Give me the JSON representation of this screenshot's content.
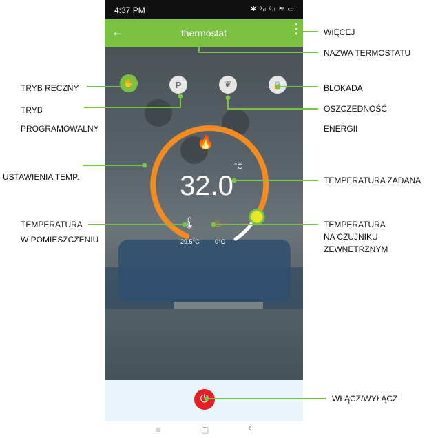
{
  "status_bar": {
    "time": "4:37 PM",
    "icons": "✱ ᵃᵢₗ ᵃᵢₗ ≋ ▭"
  },
  "app_bar": {
    "back_icon": "←",
    "title": "thermostat",
    "more_icon": "⋮"
  },
  "mode_buttons": [
    {
      "name": "manual",
      "icon": "✋",
      "active": true
    },
    {
      "name": "program",
      "icon": "P",
      "active": false
    },
    {
      "name": "eco",
      "icon": "❦",
      "active": false
    },
    {
      "name": "lock",
      "icon": "🔒",
      "active": false
    }
  ],
  "thermostat": {
    "flame_icon": "🔥",
    "unit": "°C",
    "set_temperature": "32.0",
    "room_temperature": "29.5°C",
    "floor_sensor_temperature": "0°C",
    "room_icon": "🌡",
    "floor_icon": "♨"
  },
  "power": {
    "icon": "⏻"
  },
  "nav": {
    "menu": "≡",
    "home": "▢",
    "back": "‹"
  },
  "annotations": {
    "more": "WIĘCEJ",
    "thermostat_name": "NAZWA TERMOSTATU",
    "manual_mode": "TRYB RECZNY",
    "program_mode_1": "TRYB",
    "program_mode_2": "PROGRAMOWALNY",
    "lock": "BLOKADA",
    "energy_saving_1": "OSZCZEDNOŚĆ",
    "energy_saving_2": "ENERGII",
    "temp_settings": "USTAWIENIA TEMP.",
    "set_temp": "TEMPERATURA ZADANA",
    "room_temp_1": "TEMPERATURA",
    "room_temp_2": "W POMIESZCZENIU",
    "external_temp_1": "TEMPERATURA",
    "external_temp_2": "NA CZUJNIKU",
    "external_temp_3": "ZEWNETRZNYM",
    "power": "WŁĄCZ/WYŁĄCZ"
  },
  "colors": {
    "accent": "#7cc242",
    "ring": "#f28c22",
    "power": "#e31e24",
    "knob": "#e8e629",
    "callout_line": "#7cc242"
  }
}
